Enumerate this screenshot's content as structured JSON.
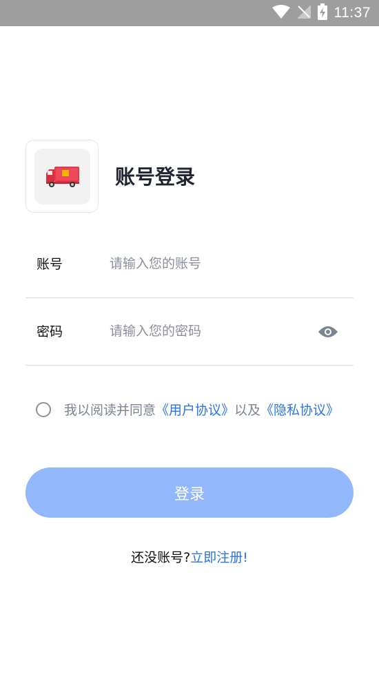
{
  "status_bar": {
    "time": "11:37"
  },
  "header": {
    "title": "账号登录"
  },
  "form": {
    "account": {
      "label": "账号",
      "placeholder": "请输入您的账号",
      "value": ""
    },
    "password": {
      "label": "密码",
      "placeholder": "请输入您的密码",
      "value": ""
    }
  },
  "agreement": {
    "checked": false,
    "prefix": "我以阅读并同意",
    "user_agreement": "《用户协议》",
    "middle": "以及",
    "privacy_agreement": "《隐私协议》"
  },
  "login_button": {
    "label": "登录"
  },
  "register": {
    "prompt": "还没账号?",
    "link": "立即注册!"
  },
  "colors": {
    "accent": "#2a74e8",
    "button": "#93b7fb",
    "status_bar": "#9e9e9e"
  }
}
